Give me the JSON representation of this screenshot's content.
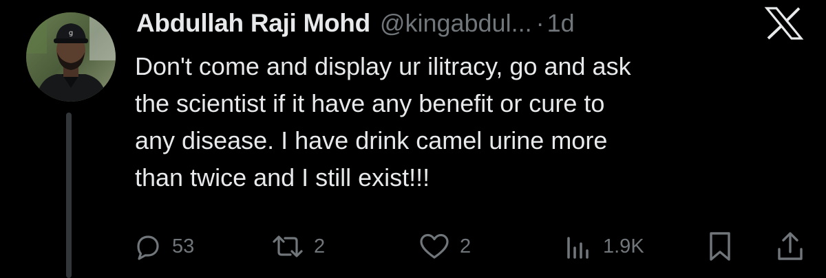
{
  "tweet": {
    "author": {
      "display_name": "Abdullah Raji Mohd",
      "handle": "@kingabdul...",
      "avatar_icon": "user-photo"
    },
    "separator": "·",
    "timestamp": "1d",
    "brand_icon": "x-logo-icon",
    "text": "Don't come and display ur ilitracy, go and ask\nthe scientist if it have any benefit or cure to\nany disease. I have drink camel urine more\nthan twice and I still exist!!!",
    "actions": {
      "replies": {
        "icon": "reply-icon",
        "count": "53"
      },
      "reposts": {
        "icon": "repost-icon",
        "count": "2"
      },
      "likes": {
        "icon": "heart-icon",
        "count": "2"
      },
      "views": {
        "icon": "views-icon",
        "count": "1.9K"
      },
      "bookmark": {
        "icon": "bookmark-icon"
      },
      "share": {
        "icon": "share-icon"
      }
    }
  },
  "colors": {
    "background": "#000000",
    "primary_text": "#e7e9ea",
    "secondary_text": "#71767b",
    "thread_line": "#333639"
  }
}
